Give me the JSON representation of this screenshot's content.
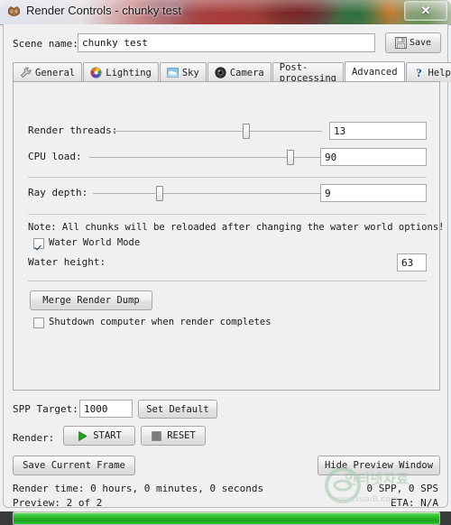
{
  "window": {
    "title": "Render Controls - chunky test",
    "app_icon": "chunky-app-icon",
    "close_label": "✕"
  },
  "scene": {
    "label": "Scene name:",
    "value": "chunky test",
    "placeholder": "",
    "save_label": "Save",
    "save_icon": "floppy-disk-icon"
  },
  "tabs": [
    {
      "label": "General",
      "icon": "wrench-icon",
      "selected": false
    },
    {
      "label": "Lighting",
      "icon": "color-wheel-icon",
      "selected": false
    },
    {
      "label": "Sky",
      "icon": "cloud-sky-icon",
      "selected": false
    },
    {
      "label": "Camera",
      "icon": "camera-lens-icon",
      "selected": false
    },
    {
      "label": "Post-processing",
      "icon": "",
      "selected": false
    },
    {
      "label": "Advanced",
      "icon": "",
      "selected": true
    },
    {
      "label": "Help",
      "icon": "question-mark-icon",
      "selected": false
    }
  ],
  "advanced": {
    "render_threads": {
      "label": "Render threads:",
      "value": "13",
      "percent": 64
    },
    "cpu_load": {
      "label": "CPU load:",
      "value": "90",
      "percent": 88
    },
    "ray_depth": {
      "label": "Ray depth:",
      "value": "9",
      "percent": 27
    },
    "note": "Note: All chunks will be reloaded after changing the water world options!",
    "water_world_mode": {
      "label": "Water World Mode",
      "checked": true
    },
    "water_height": {
      "label": "Water height:",
      "value": "63"
    },
    "merge_render_dump_label": "Merge Render Dump",
    "shutdown": {
      "label": "Shutdown computer when render completes",
      "checked": false
    }
  },
  "bottom": {
    "spp_target_label": "SPP Target:",
    "spp_target_value": "1000",
    "set_default_label": "Set Default",
    "render_label": "Render:",
    "start_label": "START",
    "start_icon": "play-triangle-icon",
    "reset_label": "RESET",
    "reset_icon": "stop-square-icon",
    "save_current_frame_label": "Save Current Frame",
    "hide_preview_label": "Hide Preview Window",
    "render_time": "Render time: 0 hours, 0 minutes, 0 seconds",
    "spp_sps": "0 SPP, 0 SPS",
    "preview": "Preview: 2 of 2",
    "eta": "ETA: N/A",
    "progress_percent": 100
  },
  "watermark": {
    "hangul": "인터넷자료",
    "url": "www.xuaiB.com"
  },
  "colors": {
    "accent_green": "#2bbd2b",
    "panel_bg": "#f0f0f0",
    "border": "#a9a9a9",
    "text": "#1b1b1b"
  }
}
